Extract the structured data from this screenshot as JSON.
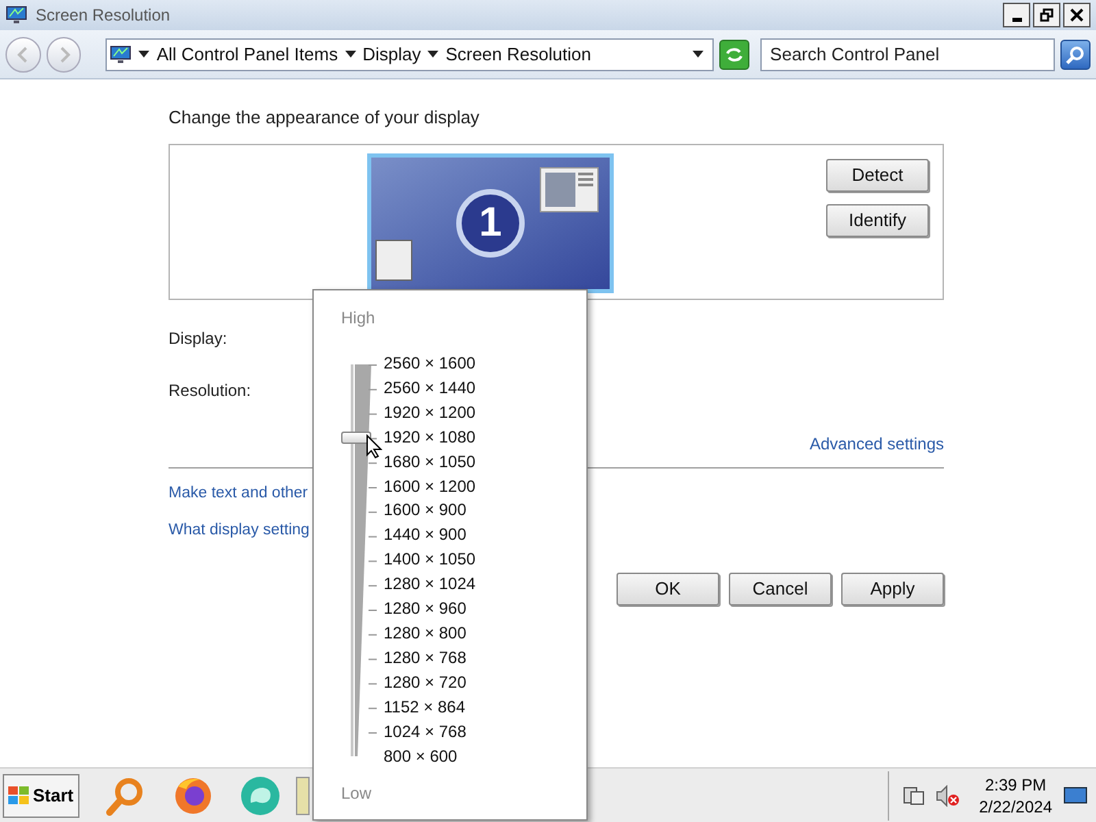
{
  "window": {
    "title": "Screen Resolution"
  },
  "address_bar": {
    "breadcrumbs": [
      "All Control Panel Items",
      "Display",
      "Screen Resolution"
    ]
  },
  "search": {
    "placeholder": "Search Control Panel"
  },
  "heading": "Change the appearance of your display",
  "monitor": {
    "label": "1",
    "selected": true
  },
  "side_buttons": [
    "Detect",
    "Identify"
  ],
  "fields": [
    {
      "label": "Display:"
    },
    {
      "label": "Resolution:"
    }
  ],
  "advanced_link": "Advanced settings",
  "links": [
    "Make text and other",
    "What display setting"
  ],
  "buttons": [
    "OK",
    "Cancel",
    "Apply"
  ],
  "resolution_popup": {
    "top_label": "High",
    "bottom_label": "Low",
    "level": 0.8125,
    "options": [
      "2560 × 1600",
      "2560 × 1440",
      "1920 × 1200",
      "1920 × 1080",
      "1680 × 1050",
      "1600 × 1200",
      "1600 × 900",
      "1440 × 900",
      "1400 × 1050",
      "1280 × 1024",
      "1280 × 960",
      "1280 × 800",
      "1280 × 768",
      "1280 × 720",
      "1152 × 864",
      "1024 × 768",
      "800 × 600"
    ]
  },
  "taskbar": {
    "start": "Start",
    "time": "2:39 PM",
    "date": "2/22/2024"
  }
}
